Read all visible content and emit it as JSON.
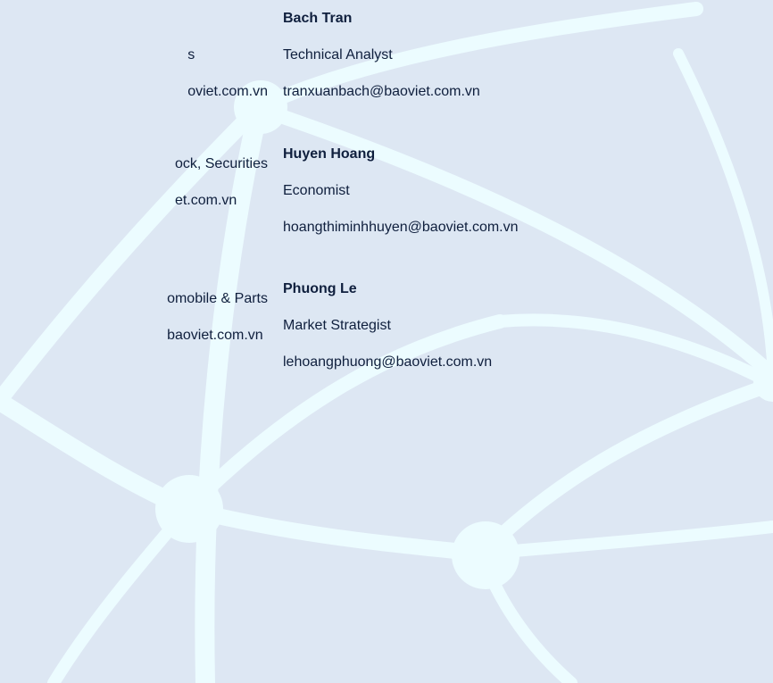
{
  "left_column": [
    {
      "title_fragment": "s",
      "email_fragment": "oviet.com.vn"
    },
    {
      "title_fragment": "ock, Securities",
      "email_fragment": "et.com.vn"
    },
    {
      "title_fragment": "omobile & Parts",
      "email_fragment": "baoviet.com.vn"
    }
  ],
  "right_column": [
    {
      "name": "Bach Tran",
      "title": "Technical Analyst",
      "email": "tranxuanbach@baoviet.com.vn"
    },
    {
      "name": "Huyen Hoang",
      "title": "Economist",
      "email": "hoangthiminhhuyen@baoviet.com.vn"
    },
    {
      "name": "Phuong Le",
      "title": "Market Strategist",
      "email": "lehoangphuong@baoviet.com.vn"
    }
  ],
  "colors": {
    "background": "#dde7f3",
    "globe_lines": "#e9fbff",
    "text": "#0f1f3d"
  }
}
